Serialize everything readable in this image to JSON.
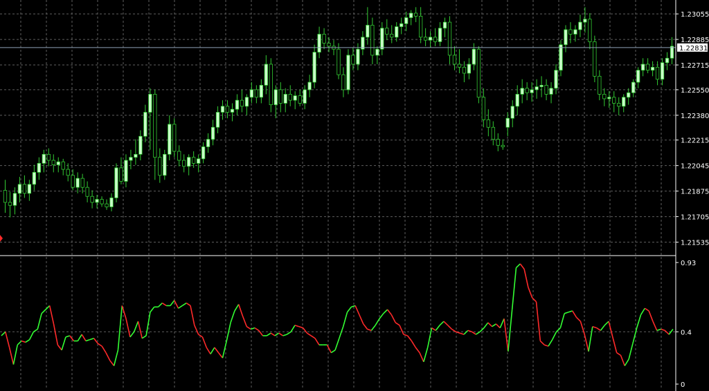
{
  "colors": {
    "background": "#000000",
    "grid": "#5f5f5f",
    "text": "#ffffff",
    "bull_candle": "#c8ffc8",
    "bear_candle": "#000000",
    "wick": "#33cc33",
    "osc_up": "#33ff33",
    "osc_down": "#ff2a2a",
    "current_price_line": "#8fa3b8"
  },
  "chart_data": [
    {
      "type": "candlestick",
      "title": "",
      "y_ticks": [
        "1.23055",
        "1.22885",
        "1.22715",
        "1.22550",
        "1.22380",
        "1.22215",
        "1.22045",
        "1.21875",
        "1.21705",
        "1.21535"
      ],
      "ylim": [
        1.2145,
        1.2312
      ],
      "current_price": 1.22831,
      "current_price_label": "1.22831",
      "grid": true,
      "candles": [
        [
          1.2188,
          1.2195,
          1.2173,
          1.218
        ],
        [
          1.218,
          1.2187,
          1.217,
          1.2178
        ],
        [
          1.2178,
          1.219,
          1.2172,
          1.2186
        ],
        [
          1.2186,
          1.2197,
          1.218,
          1.2192
        ],
        [
          1.2192,
          1.2198,
          1.2183,
          1.2186
        ],
        [
          1.2186,
          1.2195,
          1.2181,
          1.2192
        ],
        [
          1.2192,
          1.2205,
          1.2188,
          1.22
        ],
        [
          1.22,
          1.221,
          1.2195,
          1.2206
        ],
        [
          1.2206,
          1.2215,
          1.22,
          1.2212
        ],
        [
          1.2212,
          1.2216,
          1.2204,
          1.2208
        ],
        [
          1.2208,
          1.2212,
          1.22,
          1.2205
        ],
        [
          1.2205,
          1.221,
          1.22,
          1.2207
        ],
        [
          1.2207,
          1.2209,
          1.2198,
          1.2202
        ],
        [
          1.2202,
          1.2206,
          1.2194,
          1.2198
        ],
        [
          1.2198,
          1.2202,
          1.2188,
          1.219
        ],
        [
          1.219,
          1.22,
          1.2186,
          1.2196
        ],
        [
          1.2196,
          1.2199,
          1.2186,
          1.219
        ],
        [
          1.219,
          1.2194,
          1.218,
          1.2184
        ],
        [
          1.2184,
          1.2188,
          1.2176,
          1.218
        ],
        [
          1.218,
          1.2185,
          1.2176,
          1.2182
        ],
        [
          1.2182,
          1.2184,
          1.2177,
          1.2179
        ],
        [
          1.2179,
          1.2182,
          1.2175,
          1.2177
        ],
        [
          1.2177,
          1.2186,
          1.2174,
          1.2183
        ],
        [
          1.2183,
          1.2206,
          1.218,
          1.2203
        ],
        [
          1.2203,
          1.221,
          1.2192,
          1.2194
        ],
        [
          1.2194,
          1.2212,
          1.219,
          1.2208
        ],
        [
          1.2208,
          1.2215,
          1.2202,
          1.221
        ],
        [
          1.221,
          1.2222,
          1.2205,
          1.2212
        ],
        [
          1.2212,
          1.2228,
          1.2208,
          1.2224
        ],
        [
          1.2224,
          1.2245,
          1.222,
          1.224
        ],
        [
          1.224,
          1.2256,
          1.2215,
          1.2252
        ],
        [
          1.2252,
          1.2255,
          1.2195,
          1.221
        ],
        [
          1.221,
          1.2216,
          1.2193,
          1.2198
        ],
        [
          1.2198,
          1.2215,
          1.2195,
          1.2212
        ],
        [
          1.2212,
          1.2238,
          1.2208,
          1.2232
        ],
        [
          1.2232,
          1.2236,
          1.221,
          1.2214
        ],
        [
          1.2214,
          1.2218,
          1.2204,
          1.2208
        ],
        [
          1.2208,
          1.2212,
          1.22,
          1.2204
        ],
        [
          1.2204,
          1.2212,
          1.2198,
          1.221
        ],
        [
          1.221,
          1.2214,
          1.2203,
          1.2206
        ],
        [
          1.2206,
          1.2212,
          1.22,
          1.2209
        ],
        [
          1.2209,
          1.222,
          1.2206,
          1.2217
        ],
        [
          1.2217,
          1.2226,
          1.2213,
          1.2222
        ],
        [
          1.2222,
          1.2235,
          1.2218,
          1.223
        ],
        [
          1.223,
          1.2244,
          1.2226,
          1.224
        ],
        [
          1.224,
          1.2248,
          1.2235,
          1.2244
        ],
        [
          1.2244,
          1.2248,
          1.2236,
          1.224
        ],
        [
          1.224,
          1.2246,
          1.2234,
          1.2242
        ],
        [
          1.2242,
          1.2252,
          1.2238,
          1.2248
        ],
        [
          1.2248,
          1.2255,
          1.224,
          1.2244
        ],
        [
          1.2244,
          1.2252,
          1.2238,
          1.225
        ],
        [
          1.225,
          1.226,
          1.2246,
          1.2255
        ],
        [
          1.2255,
          1.2258,
          1.2246,
          1.225
        ],
        [
          1.225,
          1.2262,
          1.2246,
          1.2258
        ],
        [
          1.2258,
          1.2278,
          1.2252,
          1.2272
        ],
        [
          1.2272,
          1.2276,
          1.224,
          1.2245
        ],
        [
          1.2245,
          1.2258,
          1.2236,
          1.2255
        ],
        [
          1.2255,
          1.226,
          1.224,
          1.2246
        ],
        [
          1.2246,
          1.2256,
          1.224,
          1.2252
        ],
        [
          1.2252,
          1.2258,
          1.2244,
          1.2248
        ],
        [
          1.2248,
          1.2254,
          1.2242,
          1.2251
        ],
        [
          1.2251,
          1.2255,
          1.2244,
          1.2246
        ],
        [
          1.2246,
          1.2258,
          1.2242,
          1.2255
        ],
        [
          1.2255,
          1.2265,
          1.225,
          1.226
        ],
        [
          1.226,
          1.2285,
          1.2256,
          1.228
        ],
        [
          1.228,
          1.2297,
          1.2276,
          1.2292
        ],
        [
          1.2292,
          1.2296,
          1.2282,
          1.2286
        ],
        [
          1.2286,
          1.229,
          1.228,
          1.2284
        ],
        [
          1.2284,
          1.2288,
          1.2278,
          1.2282
        ],
        [
          1.2282,
          1.2286,
          1.2262,
          1.2265
        ],
        [
          1.2265,
          1.227,
          1.225,
          1.2255
        ],
        [
          1.2255,
          1.2282,
          1.2252,
          1.2278
        ],
        [
          1.2278,
          1.2283,
          1.2268,
          1.2272
        ],
        [
          1.2272,
          1.2286,
          1.2268,
          1.2282
        ],
        [
          1.2282,
          1.2294,
          1.2278,
          1.229
        ],
        [
          1.229,
          1.231,
          1.2285,
          1.2298
        ],
        [
          1.2298,
          1.2303,
          1.2272,
          1.2278
        ],
        [
          1.2278,
          1.2284,
          1.2272,
          1.2282
        ],
        [
          1.2282,
          1.23,
          1.2278,
          1.2296
        ],
        [
          1.2296,
          1.2302,
          1.2288,
          1.2292
        ],
        [
          1.2292,
          1.2298,
          1.2286,
          1.229
        ],
        [
          1.229,
          1.23,
          1.2287,
          1.2297
        ],
        [
          1.2297,
          1.2303,
          1.2292,
          1.2299
        ],
        [
          1.2299,
          1.2307,
          1.2294,
          1.2303
        ],
        [
          1.2303,
          1.2308,
          1.2298,
          1.2306
        ],
        [
          1.2306,
          1.231,
          1.23,
          1.2304
        ],
        [
          1.2304,
          1.231,
          1.2286,
          1.229
        ],
        [
          1.229,
          1.2296,
          1.2284,
          1.2288
        ],
        [
          1.2288,
          1.2294,
          1.2283,
          1.229
        ],
        [
          1.229,
          1.2296,
          1.2284,
          1.2287
        ],
        [
          1.2287,
          1.23,
          1.2284,
          1.2296
        ],
        [
          1.2296,
          1.2303,
          1.229,
          1.23
        ],
        [
          1.23,
          1.2304,
          1.2272,
          1.2278
        ],
        [
          1.2278,
          1.2284,
          1.2268,
          1.2272
        ],
        [
          1.2272,
          1.2282,
          1.2266,
          1.227
        ],
        [
          1.227,
          1.2274,
          1.226,
          1.2266
        ],
        [
          1.2266,
          1.2276,
          1.2262,
          1.2272
        ],
        [
          1.2272,
          1.2286,
          1.2268,
          1.2282
        ],
        [
          1.2282,
          1.2284,
          1.2246,
          1.225
        ],
        [
          1.225,
          1.2256,
          1.223,
          1.2235
        ],
        [
          1.2235,
          1.2242,
          1.2224,
          1.223
        ],
        [
          1.223,
          1.2234,
          1.2218,
          1.2222
        ],
        [
          1.2222,
          1.2226,
          1.2214,
          1.2218
        ],
        [
          1.2218,
          1.2222,
          1.2215,
          1.2217
        ],
        [
          1.223,
          1.224,
          1.2224,
          1.2236
        ],
        [
          1.2236,
          1.2248,
          1.223,
          1.2244
        ],
        [
          1.2244,
          1.2258,
          1.2238,
          1.2252
        ],
        [
          1.2252,
          1.2262,
          1.2246,
          1.2256
        ],
        [
          1.2256,
          1.226,
          1.2248,
          1.2253
        ],
        [
          1.2253,
          1.226,
          1.2247,
          1.2255
        ],
        [
          1.2255,
          1.2262,
          1.2249,
          1.2257
        ],
        [
          1.2257,
          1.2264,
          1.225,
          1.2258
        ],
        [
          1.2258,
          1.2262,
          1.2248,
          1.2252
        ],
        [
          1.2252,
          1.226,
          1.2246,
          1.2256
        ],
        [
          1.2256,
          1.2272,
          1.2252,
          1.2268
        ],
        [
          1.2268,
          1.2288,
          1.2264,
          1.2285
        ],
        [
          1.2285,
          1.2298,
          1.228,
          1.2295
        ],
        [
          1.2295,
          1.23,
          1.2286,
          1.2292
        ],
        [
          1.2292,
          1.2298,
          1.2287,
          1.2295
        ],
        [
          1.2295,
          1.2305,
          1.229,
          1.23
        ],
        [
          1.23,
          1.231,
          1.2293,
          1.2302
        ],
        [
          1.2302,
          1.2306,
          1.2282,
          1.2287
        ],
        [
          1.2287,
          1.2291,
          1.226,
          1.2264
        ],
        [
          1.2264,
          1.2268,
          1.2248,
          1.2252
        ],
        [
          1.2252,
          1.2256,
          1.2244,
          1.2249
        ],
        [
          1.2249,
          1.2254,
          1.2243,
          1.225
        ],
        [
          1.225,
          1.2254,
          1.224,
          1.2246
        ],
        [
          1.2246,
          1.225,
          1.2238,
          1.2244
        ],
        [
          1.2244,
          1.2252,
          1.224,
          1.225
        ],
        [
          1.225,
          1.2256,
          1.2245,
          1.2253
        ],
        [
          1.2253,
          1.2262,
          1.225,
          1.226
        ],
        [
          1.226,
          1.227,
          1.2256,
          1.2268
        ],
        [
          1.2268,
          1.2276,
          1.2264,
          1.2272
        ],
        [
          1.2272,
          1.2276,
          1.2266,
          1.2268
        ],
        [
          1.2268,
          1.2274,
          1.2264,
          1.227
        ],
        [
          1.227,
          1.2274,
          1.2258,
          1.2262
        ],
        [
          1.2262,
          1.2276,
          1.2258,
          1.2273
        ],
        [
          1.2273,
          1.228,
          1.2268,
          1.2276
        ],
        [
          1.2276,
          1.229,
          1.2272,
          1.2284
        ]
      ]
    },
    {
      "type": "line",
      "title": "",
      "y_ticks": [
        "0.93",
        "0.4",
        "0"
      ],
      "ylim": [
        0,
        0.93
      ],
      "colors_by_direction": true,
      "values": [
        0.37,
        0.4,
        0.28,
        0.15,
        0.3,
        0.33,
        0.32,
        0.34,
        0.4,
        0.42,
        0.54,
        0.57,
        0.6,
        0.46,
        0.3,
        0.26,
        0.36,
        0.37,
        0.33,
        0.33,
        0.38,
        0.33,
        0.34,
        0.35,
        0.31,
        0.29,
        0.24,
        0.18,
        0.14,
        0.26,
        0.6,
        0.5,
        0.36,
        0.4,
        0.48,
        0.35,
        0.37,
        0.55,
        0.59,
        0.59,
        0.62,
        0.6,
        0.6,
        0.64,
        0.58,
        0.6,
        0.62,
        0.6,
        0.45,
        0.38,
        0.36,
        0.28,
        0.23,
        0.28,
        0.24,
        0.2,
        0.33,
        0.47,
        0.56,
        0.61,
        0.52,
        0.44,
        0.42,
        0.43,
        0.41,
        0.37,
        0.37,
        0.39,
        0.37,
        0.39,
        0.37,
        0.38,
        0.4,
        0.45,
        0.44,
        0.43,
        0.39,
        0.37,
        0.35,
        0.3,
        0.3,
        0.3,
        0.24,
        0.26,
        0.35,
        0.44,
        0.55,
        0.59,
        0.6,
        0.53,
        0.46,
        0.42,
        0.41,
        0.45,
        0.5,
        0.54,
        0.57,
        0.53,
        0.47,
        0.45,
        0.38,
        0.37,
        0.33,
        0.28,
        0.24,
        0.17,
        0.28,
        0.43,
        0.41,
        0.45,
        0.48,
        0.45,
        0.42,
        0.4,
        0.39,
        0.38,
        0.41,
        0.4,
        0.38,
        0.4,
        0.43,
        0.47,
        0.44,
        0.46,
        0.43,
        0.5,
        0.25,
        0.57,
        0.89,
        0.92,
        0.88,
        0.74,
        0.66,
        0.63,
        0.33,
        0.3,
        0.29,
        0.34,
        0.4,
        0.43,
        0.54,
        0.55,
        0.56,
        0.51,
        0.48,
        0.38,
        0.25,
        0.44,
        0.43,
        0.41,
        0.45,
        0.48,
        0.36,
        0.24,
        0.22,
        0.14,
        0.19,
        0.31,
        0.43,
        0.53,
        0.58,
        0.56,
        0.48,
        0.41,
        0.42,
        0.41,
        0.38,
        0.42
      ]
    }
  ]
}
